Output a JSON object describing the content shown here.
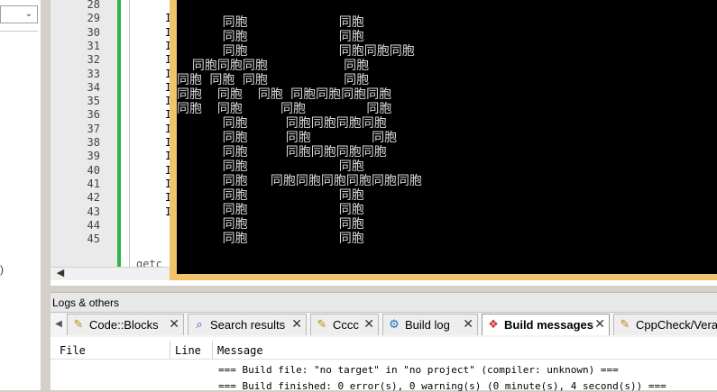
{
  "editor": {
    "line_numbers": [
      "28",
      "29",
      "30",
      "31",
      "32",
      "33",
      "34",
      "35",
      "36",
      "37",
      "38",
      "39",
      "40",
      "41",
      "42",
      "43",
      "44",
      "45"
    ],
    "code_fragment": "getc",
    "line_code_char": "I"
  },
  "console": {
    "top_partial": "    ...              ...",
    "lines": [
      "      同胞            同胞",
      "      同胞            同胞",
      "      同胞            同胞同胞同胞",
      "  同胞同胞同胞          同胞",
      "同胞 同胞 同胞          同胞",
      "同胞  同胞  同胞 同胞同胞同胞同胞",
      "同胞  同胞     同胞        同胞",
      "      同胞     同胞同胞同胞同胞",
      "      同胞     同胞        同胞",
      "      同胞     同胞同胞同胞同胞",
      "      同胞            同胞",
      "      同胞   同胞同胞同胞同胞同胞同胞",
      "      同胞            同胞",
      "      同胞            同胞",
      "      同胞            同胞",
      "      同胞            同胞"
    ]
  },
  "left_panel": {
    "paren_text": ")"
  },
  "logs": {
    "title": "Logs & others",
    "tabs": [
      {
        "label": "Code::Blocks",
        "icon": "pencil-icon"
      },
      {
        "label": "Search results",
        "icon": "search-icon"
      },
      {
        "label": "Cccc",
        "icon": "pencil-icon"
      },
      {
        "label": "Build log",
        "icon": "gear-icon"
      },
      {
        "label": "Build messages",
        "icon": "pin-icon",
        "active": true
      },
      {
        "label": "CppCheck/Vera++",
        "icon": "pencil-icon"
      }
    ],
    "columns": [
      "File",
      "Line",
      "Message"
    ],
    "messages": [
      "=== Build file: \"no target\" in \"no project\" (compiler: unknown) ===",
      "=== Build finished: 0 error(s), 0 warning(s) (0 minute(s), 4 second(s)) ==="
    ]
  }
}
